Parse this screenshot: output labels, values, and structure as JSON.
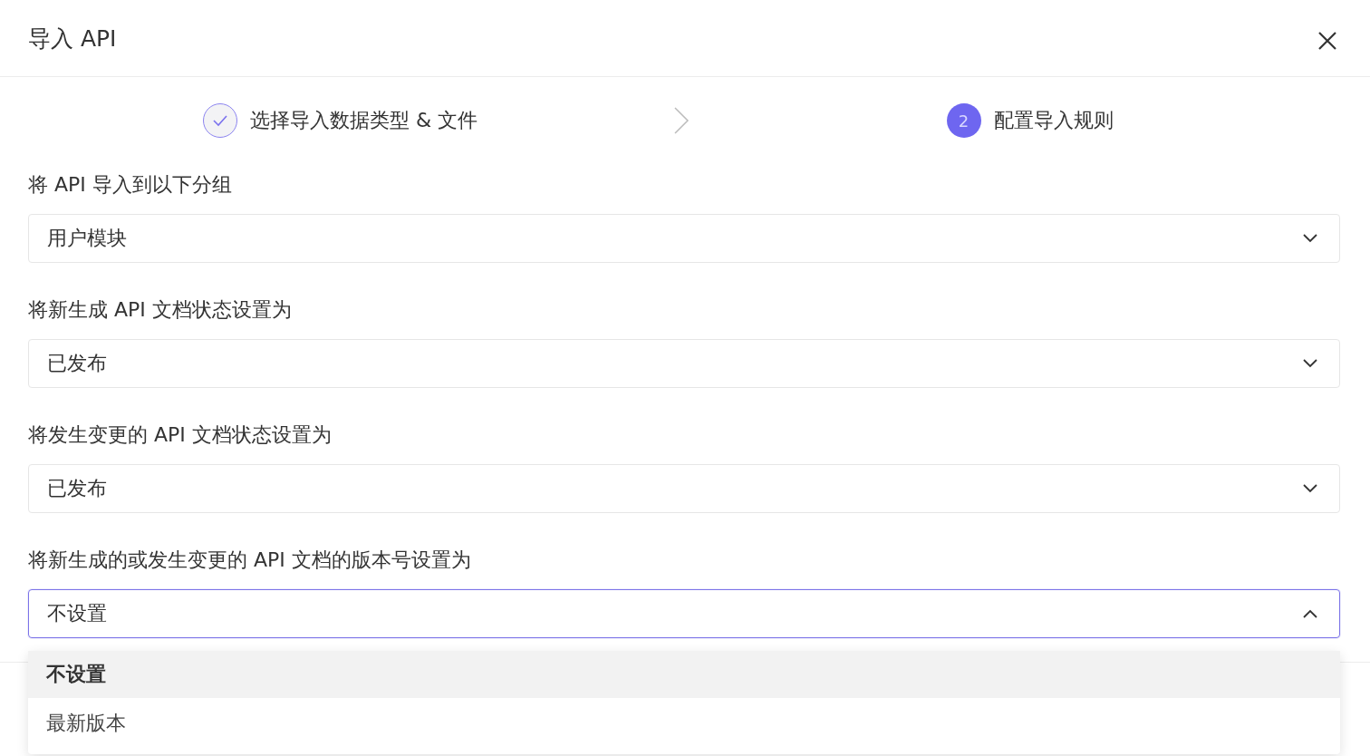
{
  "dialog": {
    "title": "导入 API"
  },
  "steps": [
    {
      "label": "选择导入数据类型 & 文件",
      "done": true
    },
    {
      "number": "2",
      "label": "配置导入规则",
      "done": false
    }
  ],
  "fields": [
    {
      "label": "将 API 导入到以下分组",
      "value": "用户模块",
      "expanded": false
    },
    {
      "label": "将新生成 API 文档状态设置为",
      "value": "已发布",
      "expanded": false
    },
    {
      "label": "将发生变更的 API 文档状态设置为",
      "value": "已发布",
      "expanded": false
    },
    {
      "label": "将新生成的或发生变更的 API 文档的版本号设置为",
      "value": "不设置",
      "expanded": true,
      "options": [
        {
          "label": "不设置",
          "selected": true
        },
        {
          "label": "最新版本",
          "selected": false
        }
      ]
    }
  ]
}
